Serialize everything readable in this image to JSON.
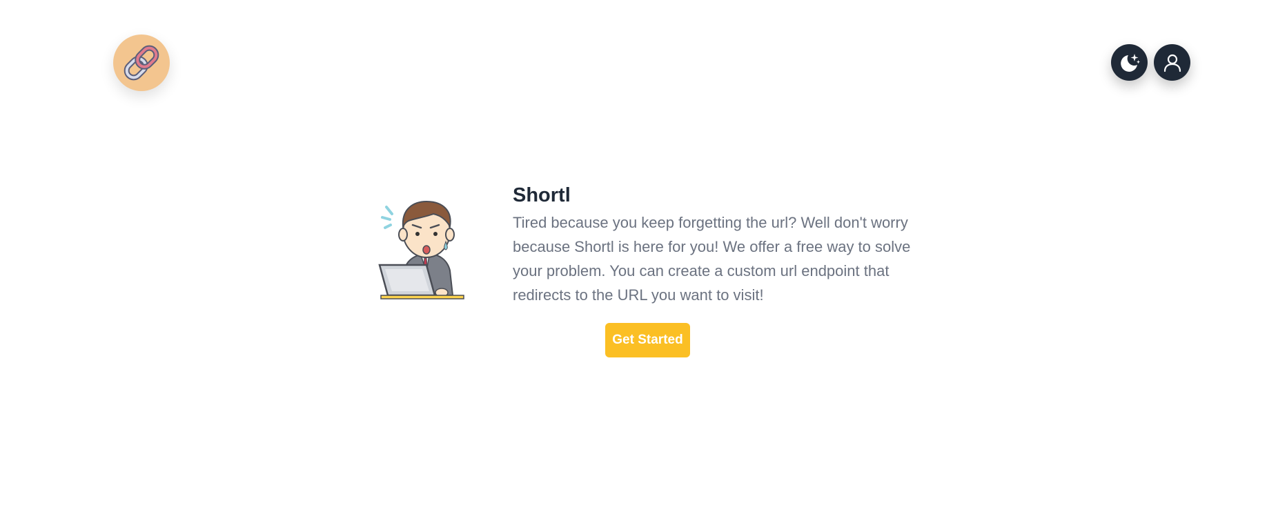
{
  "header": {
    "logo_icon": "chain-link-icon",
    "theme_toggle_icon": "moon-stars-icon",
    "account_icon": "user-icon"
  },
  "hero": {
    "title": "Shortl",
    "description": "Tired because you keep forgetting the url? Well don't worry because Shortl is here for you! We offer a free way to solve your problem. You can create a custom url endpoint that redirects to the URL you want to visit!",
    "cta_label": "Get Started"
  },
  "colors": {
    "logo_bg": "#f3c58f",
    "icon_button_bg": "#1f2937",
    "cta_bg": "#fbbf24",
    "title": "#1f2937",
    "body_text": "#6b7280"
  }
}
